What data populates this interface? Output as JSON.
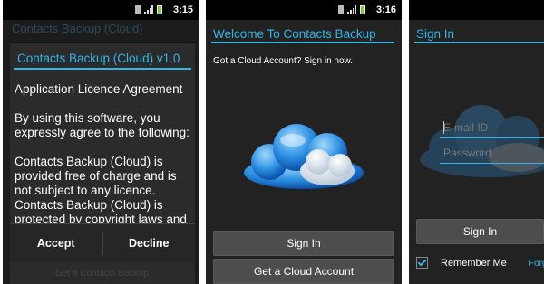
{
  "screen1": {
    "status_time": "3:15",
    "background_title": "Contacts Backup (Cloud)",
    "dialog_title": "Contacts Backup (Cloud) v1.0",
    "paragraphs": [
      "Application Licence Agreement",
      "By using this software, you expressly agree to the following:",
      "Contacts Backup (Cloud) is provided free of charge and is not subject to any licence. Contacts Backup (Cloud) is protected by copyright laws and"
    ],
    "accept_label": "Accept",
    "decline_label": "Decline",
    "background_bottom": "Get a Contacts Backup"
  },
  "screen2": {
    "status_time": "3:16",
    "title": "Welcome To Contacts Backup",
    "subtitle": "Got a Cloud Account? Sign in now.",
    "sign_in_label": "Sign In",
    "get_account_label": "Get a Cloud Account"
  },
  "screen3": {
    "title": "Sign In",
    "email_placeholder": "E-mail ID",
    "password_placeholder": "Password",
    "sign_in_label": "Sign In",
    "remember_label": "Remember Me",
    "forgot_label": "Forgot",
    "remember_checked": true
  },
  "colors": {
    "accent": "#33b5e5",
    "background": "#222222",
    "button": "#4d4d4d"
  }
}
